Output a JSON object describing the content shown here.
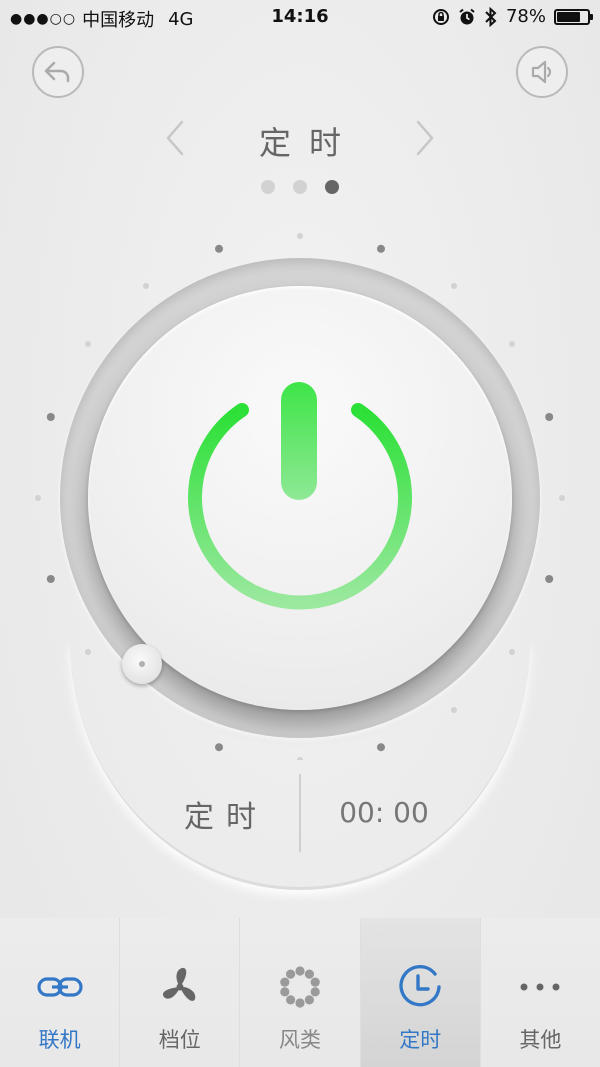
{
  "status_bar": {
    "signal": "●●●○○",
    "carrier": "中国移动",
    "network": "4G",
    "time": "14:16",
    "battery": "78%",
    "battery_level": 0.78
  },
  "header": {
    "back_icon": "back-arrow-icon",
    "sound_icon": "speaker-icon",
    "title": "定时",
    "page_count": 3,
    "active_page": 3
  },
  "dial": {
    "center_icon": "power-icon",
    "power_color": "#3fe34a"
  },
  "timer": {
    "label": "定时",
    "value": "00: 00"
  },
  "tabs": [
    {
      "label": "联机",
      "icon": "link-icon",
      "active": false
    },
    {
      "label": "档位",
      "icon": "fan-icon",
      "active": false
    },
    {
      "label": "风类",
      "icon": "wind-mode-icon",
      "active": false
    },
    {
      "label": "定时",
      "icon": "clock-icon",
      "active": true
    },
    {
      "label": "其他",
      "icon": "more-icon",
      "active": false
    }
  ],
  "colors": {
    "accent_blue": "#3378c6",
    "power_green": "#3fe34a",
    "text_gray": "#666666"
  }
}
